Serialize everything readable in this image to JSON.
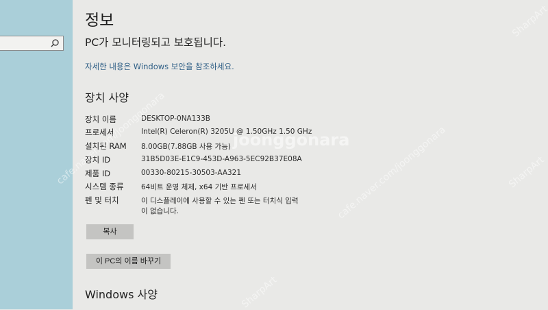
{
  "header": {
    "title": "정보",
    "protection_message": "PC가 모니터링되고 보호됩니다.",
    "security_link": "자세한 내용은 Windows 보안을 참조하세요."
  },
  "device_specs": {
    "heading": "장치 사양",
    "rows": [
      {
        "label": "장치 이름",
        "value": "DESKTOP-0NA133B"
      },
      {
        "label": "프로세서",
        "value": "Intel(R) Celeron(R) 3205U @ 1.50GHz   1.50 GHz"
      },
      {
        "label": "설치된 RAM",
        "value": "8.00GB(7.88GB 사용 가능)"
      },
      {
        "label": "장치 ID",
        "value": "31B5D03E-E1C9-453D-A963-5EC92B37E08A"
      },
      {
        "label": "제품 ID",
        "value": "00330-80215-30503-AA321"
      },
      {
        "label": "시스템 종류",
        "value": "64비트 운영 체제, x64 기반 프로세서"
      },
      {
        "label": "펜 및 터치",
        "value": "이 디스플레이에 사용할 수 있는 펜 또는 터치식 입력",
        "value_line2": "이 없습니다."
      }
    ],
    "copy_button": "복사",
    "rename_button": "이 PC의 이름 바꾸기"
  },
  "windows_specs": {
    "heading": "Windows 사양"
  },
  "watermark": {
    "main": "joonggonara",
    "diagonal": "cafe.naver.com/joonggonara",
    "corner": "SharpArt"
  }
}
